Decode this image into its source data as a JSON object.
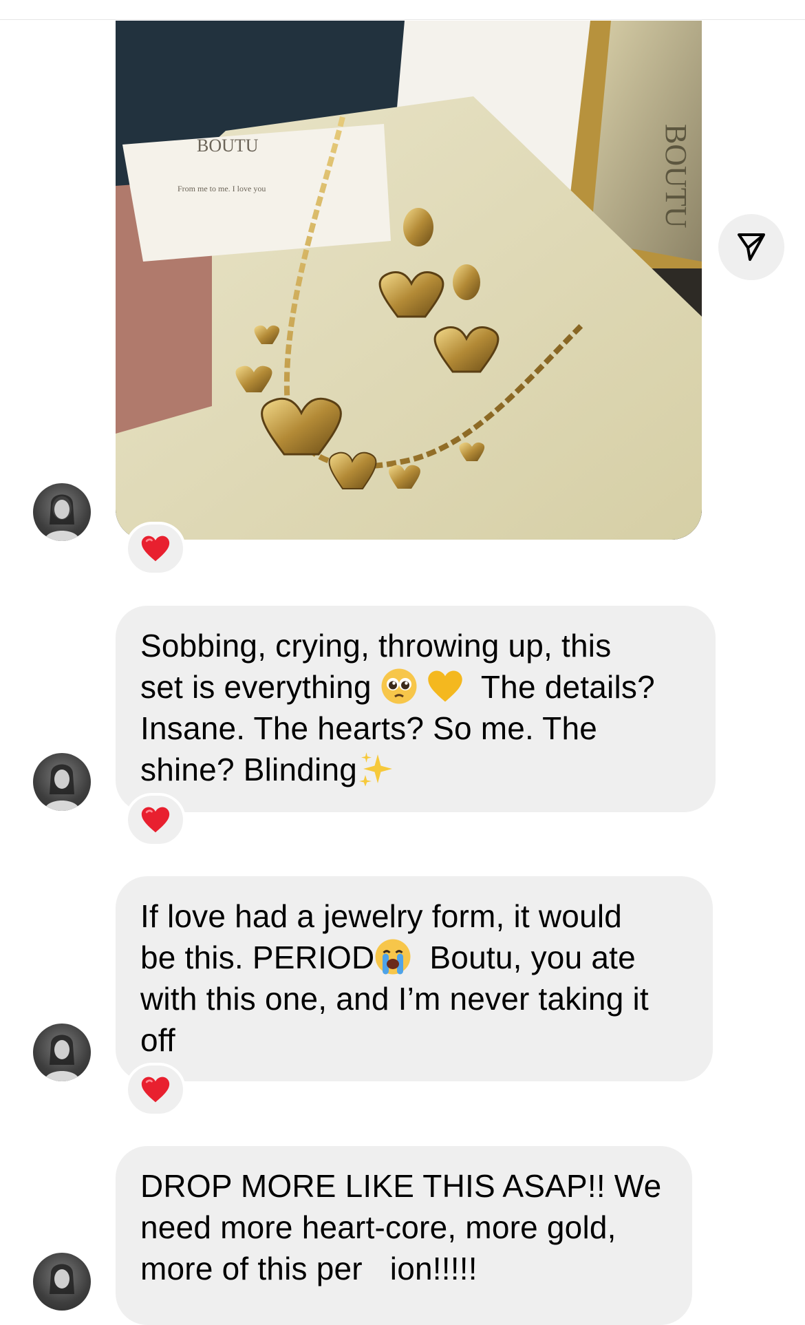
{
  "photo": {
    "brand_text": "BOUTU",
    "card_text": "From me to me. I love you",
    "alt": "BOUTU"
  },
  "icons": {
    "share": "send-icon",
    "reaction": "red-heart-icon"
  },
  "messages": [
    {
      "text_parts": [
        "Sobbing, crying, throwing up, this\nset is everything ",
        " ",
        "  The details?\nInsane. The hearts? So me. The\nshine? Blinding",
        ""
      ],
      "emojis": [
        "pleading-face-icon",
        "yellow-heart-icon",
        "sparkles-icon"
      ],
      "reaction": "❤️"
    },
    {
      "text_parts": [
        "If love had a jewelry form, it would\nbe this. PERIOD",
        "  Boutu, you ate\nwith this one, and I’m never taking it\noff"
      ],
      "emojis": [
        "loudly-crying-face-icon"
      ],
      "reaction": "❤️"
    },
    {
      "text_parts": [
        "DROP MORE LIKE THIS ASAP!! We\nneed more heart-core, more gold,\nmore of this per",
        "ion!!!!!"
      ],
      "emojis": []
    }
  ],
  "colors": {
    "bubble": "#efefef",
    "heart": "#e8202f",
    "background": "#ffffff"
  }
}
